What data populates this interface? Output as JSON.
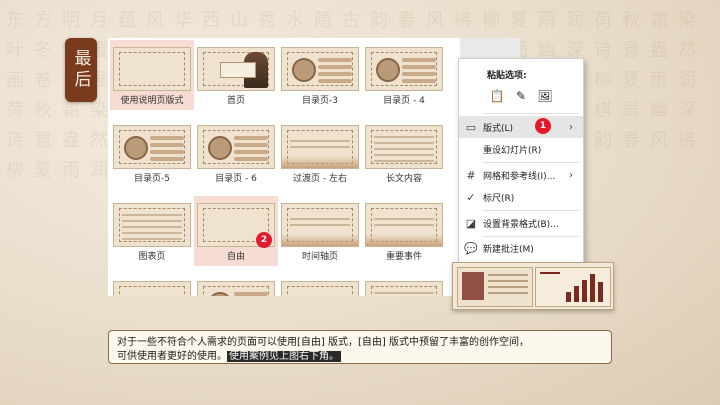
{
  "side_tag": "最后",
  "background_text": "东方明月蕴风华西山秀水隐古韵春风拂柳夏雨润荷秋霜染叶冬雪覆松书香满室墨韵流芳琴声悠扬棋局幽深诗意盎然画卷徐展东方明月蕴风华西山秀水隐古韵春风拂柳夏雨润荷秋霜染叶冬雪覆松书香满室墨韵流芳琴声悠扬棋局幽深诗意盎然画卷徐展东方明月蕴风华西山秀水隐古韵春风拂柳夏雨润荷秋霜染叶冬雪覆松",
  "layouts": [
    {
      "label": "使用说明页版式",
      "selected": true
    },
    {
      "label": "首页"
    },
    {
      "label": "目录页-3"
    },
    {
      "label": "目录页 - 4"
    },
    {
      "label": "目录页-5"
    },
    {
      "label": "目录页 - 6"
    },
    {
      "label": "过渡页 - 左右"
    },
    {
      "label": "长文内容"
    },
    {
      "label": "图表页"
    },
    {
      "label": "自由",
      "selected": true
    },
    {
      "label": "时间轴页"
    },
    {
      "label": "重要事件"
    },
    {
      "label": ""
    },
    {
      "label": ""
    },
    {
      "label": ""
    },
    {
      "label": ""
    }
  ],
  "badges": {
    "one": "1",
    "two": "2"
  },
  "context_menu": {
    "paste_header": "粘贴选项:",
    "paste_icons": [
      "paste-keep-icon",
      "paste-format-icon",
      "paste-picture-icon"
    ],
    "items": [
      {
        "label": "版式(L)",
        "icon": "layout-icon",
        "has_submenu": true,
        "hover": true
      },
      {
        "label": "重设幻灯片(R)",
        "icon": "",
        "has_submenu": false
      },
      {
        "label": "网格和参考线(I)...",
        "icon": "grid-icon",
        "has_submenu": true
      },
      {
        "label": "标尺(R)",
        "icon": "check-icon",
        "has_submenu": false
      },
      {
        "label": "设置背景格式(B)...",
        "icon": "background-format-icon",
        "has_submenu": false
      },
      {
        "label": "新建批注(M)",
        "icon": "comment-icon",
        "has_submenu": false
      }
    ]
  },
  "caption": {
    "line1": "对于一些不符合个人需求的页面可以使用[自由] 版式，[自由] 版式中预留了丰富的创作空间，",
    "line2_plain": "可供使用者更好的使用。",
    "line2_highlight": "使用案例见上图右下角。"
  },
  "colors": {
    "accent_brown": "#7a3a1d",
    "badge_red": "#e21a2c",
    "selection_pink": "#f6dcd2"
  }
}
